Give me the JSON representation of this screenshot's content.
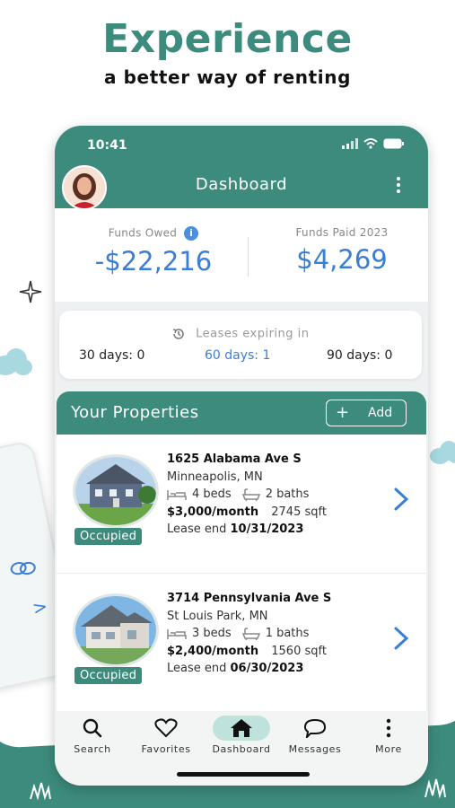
{
  "promo": {
    "headline": "Experience",
    "subline": "a better way of renting"
  },
  "status_bar": {
    "time": "10:41"
  },
  "header": {
    "title": "Dashboard",
    "menu_icon": "kebab-menu-icon"
  },
  "funds": {
    "owed_label": "Funds Owed",
    "owed_value": "-$22,216",
    "paid_label": "Funds Paid 2023",
    "paid_value": "$4,269"
  },
  "leases": {
    "title": "Leases expiring in",
    "options": [
      {
        "label": "30 days: 0",
        "active": false
      },
      {
        "label": "60 days: 1",
        "active": true
      },
      {
        "label": "90 days: 0",
        "active": false
      }
    ]
  },
  "properties": {
    "title": "Your Properties",
    "add_label": "Add",
    "items": [
      {
        "address": "1625 Alabama Ave S",
        "city": "Minneapolis, MN",
        "beds": "4 beds",
        "baths": "2 baths",
        "rent": "$3,000/month",
        "sqft": "2745 sqft",
        "lease_end_label": "Lease end",
        "lease_end": "10/31/2023",
        "status": "Occupied"
      },
      {
        "address": "3714 Pennsylvania Ave S",
        "city": "St Louis Park, MN",
        "beds": "3 beds",
        "baths": "1 baths",
        "rent": "$2,400/month",
        "sqft": "1560 sqft",
        "lease_end_label": "Lease end",
        "lease_end": "06/30/2023",
        "status": "Occupied"
      }
    ]
  },
  "nav": [
    {
      "label": "Search",
      "icon": "search-icon"
    },
    {
      "label": "Favorites",
      "icon": "heart-icon"
    },
    {
      "label": "Dashboard",
      "icon": "home-icon",
      "active": true
    },
    {
      "label": "Messages",
      "icon": "chat-bubble-icon"
    },
    {
      "label": "More",
      "icon": "more-vertical-icon"
    }
  ],
  "colors": {
    "brand_teal": "#3d8b7d",
    "accent_blue": "#3a7fd5",
    "nav_active_bg": "#bfe3dc"
  }
}
